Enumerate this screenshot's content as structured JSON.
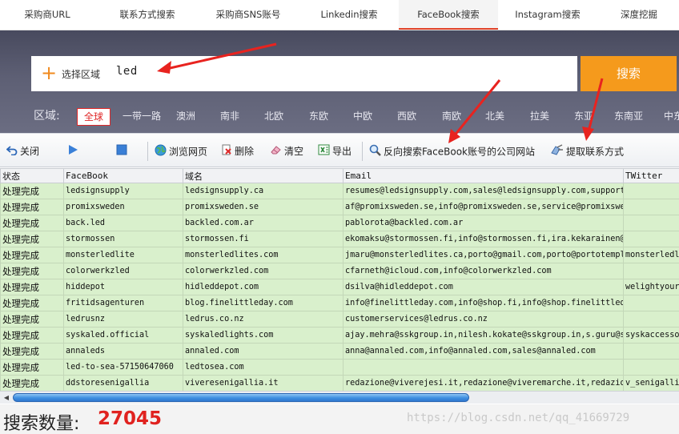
{
  "tabs": [
    {
      "label": "采购商URL",
      "active": false
    },
    {
      "label": "联系方式搜索",
      "active": false
    },
    {
      "label": "采购商SNS账号",
      "active": false
    },
    {
      "label": "Linkedin搜索",
      "active": false
    },
    {
      "label": "FaceBook搜索",
      "active": true
    },
    {
      "label": "Instagram搜索",
      "active": false
    },
    {
      "label": "深度挖掘",
      "active": false
    }
  ],
  "search": {
    "region_label": "选择区域",
    "query": "led",
    "button": "搜索"
  },
  "regions": {
    "title": "区域:",
    "items": [
      "全球",
      "一带一路",
      "澳洲",
      "南非",
      "北欧",
      "东欧",
      "中欧",
      "西欧",
      "南欧",
      "北美",
      "拉美",
      "东亚",
      "东南亚",
      "中东"
    ],
    "selected": "全球"
  },
  "toolbar": {
    "close": "关闭",
    "browse": "浏览网页",
    "delete": "删除",
    "clear": "清空",
    "export": "导出",
    "reverse_search": "反向搜索FaceBook账号的公司网站",
    "extract": "提取联系方式"
  },
  "table": {
    "columns": [
      "状态",
      "FaceBook",
      "域名",
      "Email",
      "TWitter"
    ],
    "rows": [
      [
        "处理完成",
        "ledsignsupply",
        "ledsignsupply.ca",
        "resumes@ledsignsupply.com,sales@ledsignsupply.com,support",
        ""
      ],
      [
        "处理完成",
        "promixsweden",
        "promixsweden.se",
        "af@promixsweden.se,info@promixsweden.se,service@promixswe",
        ""
      ],
      [
        "处理完成",
        "back.led",
        "backled.com.ar",
        "pablorota@backled.com.ar",
        ""
      ],
      [
        "处理完成",
        "stormossen",
        "stormossen.fi",
        "ekomaksu@stormossen.fi,info@stormossen.fi,ira.kekarainen@",
        ""
      ],
      [
        "处理完成",
        "monsterledlite",
        "monsterledlites.com",
        "jmaru@monsterledlites.ca,porto@gmail.com,porto@portotempl",
        "monsterledl"
      ],
      [
        "处理完成",
        "colorwerkzled",
        "colorwerkzled.com",
        "cfarneth@icloud.com,info@colorwerkzled.com",
        ""
      ],
      [
        "处理完成",
        "hiddepot",
        "hidleddepot.com",
        "dsilva@hidleddepot.com",
        "welightyourv"
      ],
      [
        "处理完成",
        "fritidsagenturen",
        "blog.finelittleday.com",
        "info@finelittleday.com,info@shop.fi,info@shop.finelittled",
        ""
      ],
      [
        "处理完成",
        "ledrusnz",
        "ledrus.co.nz",
        "customerservices@ledrus.co.nz",
        ""
      ],
      [
        "处理完成",
        "syskaled.official",
        "syskaledlights.com",
        "ajay.mehra@sskgroup.in,nilesh.kokate@sskgroup.in,s.guru@s",
        "syskaccesso"
      ],
      [
        "处理完成",
        "annaleds",
        "annaled.com",
        "anna@annaled.com,info@annaled.com,sales@annaled.com",
        ""
      ],
      [
        "处理完成",
        "led-to-sea-57150647060",
        "ledtosea.com",
        "",
        ""
      ],
      [
        "处理完成",
        "ddstoresenigallia",
        "viveresenigallia.it",
        "redazione@viverejesi.it,redazione@viveremarche.it,redazio",
        "v_senigalli"
      ]
    ]
  },
  "footer": {
    "count_label": "搜索数量:",
    "count_value": "27045",
    "watermark": "https://blog.csdn.net/qq_41669729"
  },
  "colors": {
    "accent_orange": "#f59a1c",
    "row_green": "#d9f0cc",
    "count_red": "#e0221f",
    "arrow_red": "#e8231f"
  }
}
